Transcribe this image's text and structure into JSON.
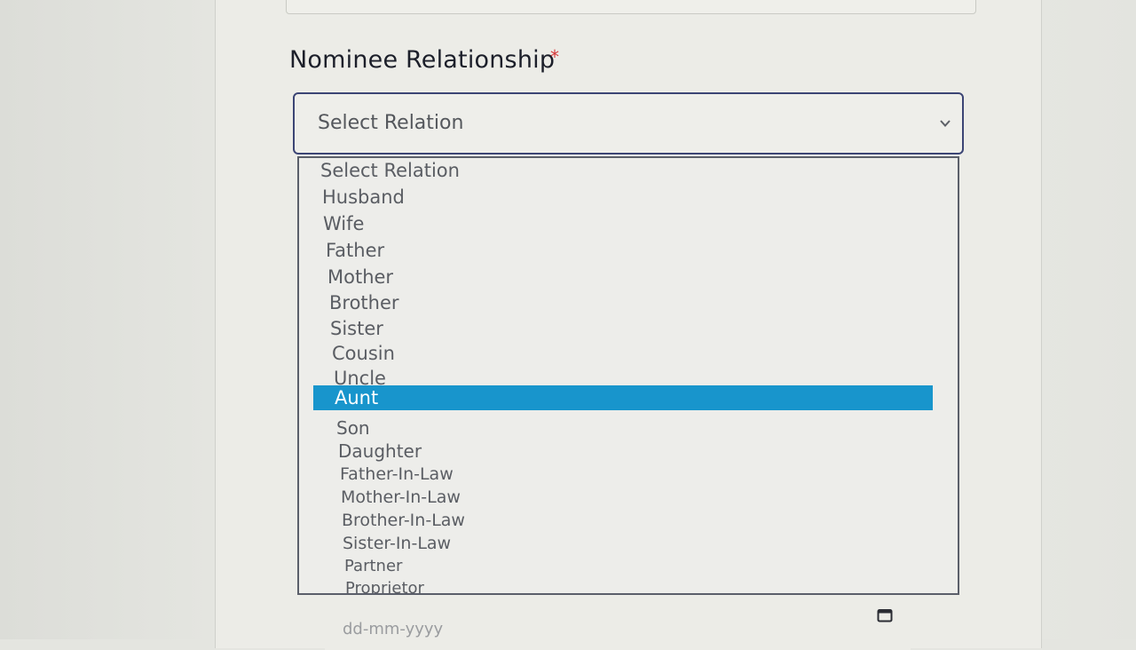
{
  "form": {
    "nominee_relationship_label": "Nominee Relationship",
    "required_marker": "*",
    "select_value": "Select Relation",
    "date_placeholder": "dd-mm-yyyy"
  },
  "dropdown": {
    "options": [
      "Select Relation",
      "Husband",
      "Wife",
      "Father",
      "Mother",
      "Brother",
      "Sister",
      "Cousin",
      "Uncle",
      "Aunt",
      "Son",
      "Daughter",
      "Father-In-Law",
      "Mother-In-Law",
      "Brother-In-Law",
      "Sister-In-Law",
      "Partner",
      "Proprietor"
    ],
    "highlighted": "Aunt"
  },
  "colors": {
    "highlight": "#1895cc",
    "required": "#d5393b",
    "select_border": "#3c4575"
  },
  "icons": {
    "select_arrow": "chevron-down-icon",
    "date_picker": "calendar-icon"
  }
}
